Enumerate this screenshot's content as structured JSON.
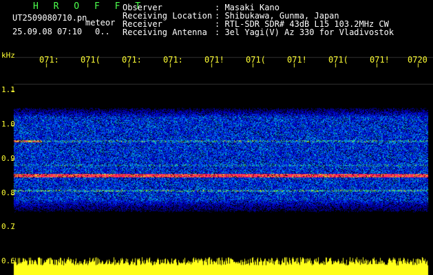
{
  "header": {
    "logo": "H R O F F T",
    "filename": "UT2509080710.pn",
    "type": "meteor",
    "datetime": "25.09.08 07:10",
    "frame": "0..",
    "fields": [
      {
        "label": "Observer",
        "value": ": Masaki Kano"
      },
      {
        "label": "Receiving Location",
        "value": ": Shibukawa, Gunma, Japan"
      },
      {
        "label": "Receiver",
        "value": ": RTL-SDR SDR# 43dB L15 103.2MHz CW"
      },
      {
        "label": "Receiving Antenna",
        "value": ": 3el Yagi(V) Az 330 for Vladivostok"
      }
    ]
  },
  "time_axis": {
    "ticks": [
      "071:",
      "071(",
      "071:",
      "071:",
      "071!",
      "071(",
      "071!",
      "071(",
      "071!",
      "0720"
    ]
  },
  "freq_axis": {
    "unit": "kHz",
    "ticks": [
      "1.1",
      "1.0",
      "0.9",
      "0.8",
      "0.7",
      "0.6"
    ]
  },
  "colors": {
    "background": "#000000",
    "text": "#ffffff",
    "accent_green": "#4dff4d",
    "axis_yellow": "#ffff33",
    "signal_red": "#ff2255"
  }
}
